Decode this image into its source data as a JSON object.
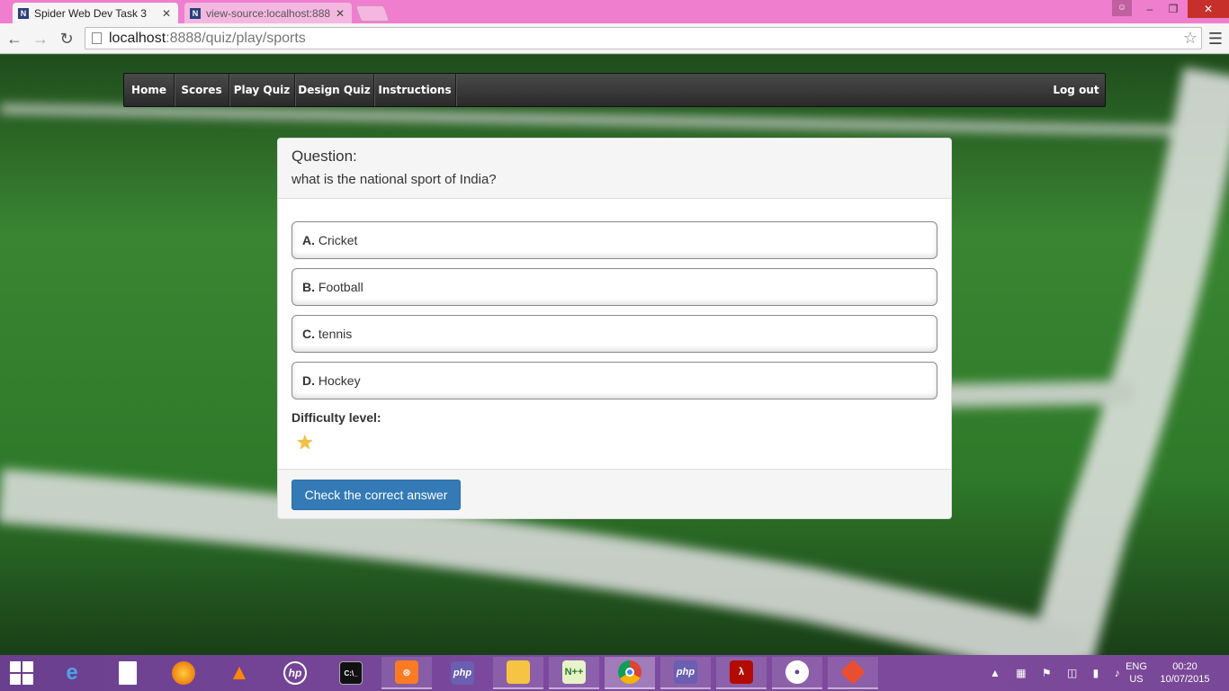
{
  "browser": {
    "tabs": [
      {
        "title": "Spider Web Dev Task 3",
        "favicon": "N",
        "active": true
      },
      {
        "title": "view-source:localhost:888",
        "favicon": "N",
        "active": false
      }
    ],
    "url_host": "localhost",
    "url_rest": ":8888/quiz/play/sports",
    "icons": {
      "back": "back-arrow-icon",
      "forward": "forward-arrow-icon",
      "reload": "reload-icon",
      "bookmark": "star-icon",
      "menu": "hamburger-menu-icon"
    }
  },
  "nav": {
    "items": [
      "Home",
      "Scores",
      "Play Quiz",
      "Design Quiz",
      "Instructions"
    ],
    "logout": "Log out"
  },
  "quiz": {
    "question_label": "Question:",
    "question_text": "what is the national sport of India?",
    "options": [
      {
        "letter": "A.",
        "text": "Cricket"
      },
      {
        "letter": "B.",
        "text": "Football"
      },
      {
        "letter": "C.",
        "text": "tennis"
      },
      {
        "letter": "D.",
        "text": "Hockey"
      }
    ],
    "difficulty_label": "Difficulty level:",
    "difficulty_stars": 1,
    "check_button": "Check the correct answer",
    "colors": {
      "primary": "#337ab7",
      "star": "#f2c33d"
    }
  },
  "taskbar": {
    "apps": [
      "internet-explorer",
      "file",
      "firefox",
      "vlc",
      "hp",
      "command-prompt",
      "xampp",
      "phpstorm",
      "file-explorer",
      "notepad-plus-plus",
      "chrome",
      "phpstorm",
      "acrobat-reader",
      "github",
      "git"
    ],
    "language": "ENG",
    "region": "US",
    "time": "00:20",
    "date": "10/07/2015"
  }
}
